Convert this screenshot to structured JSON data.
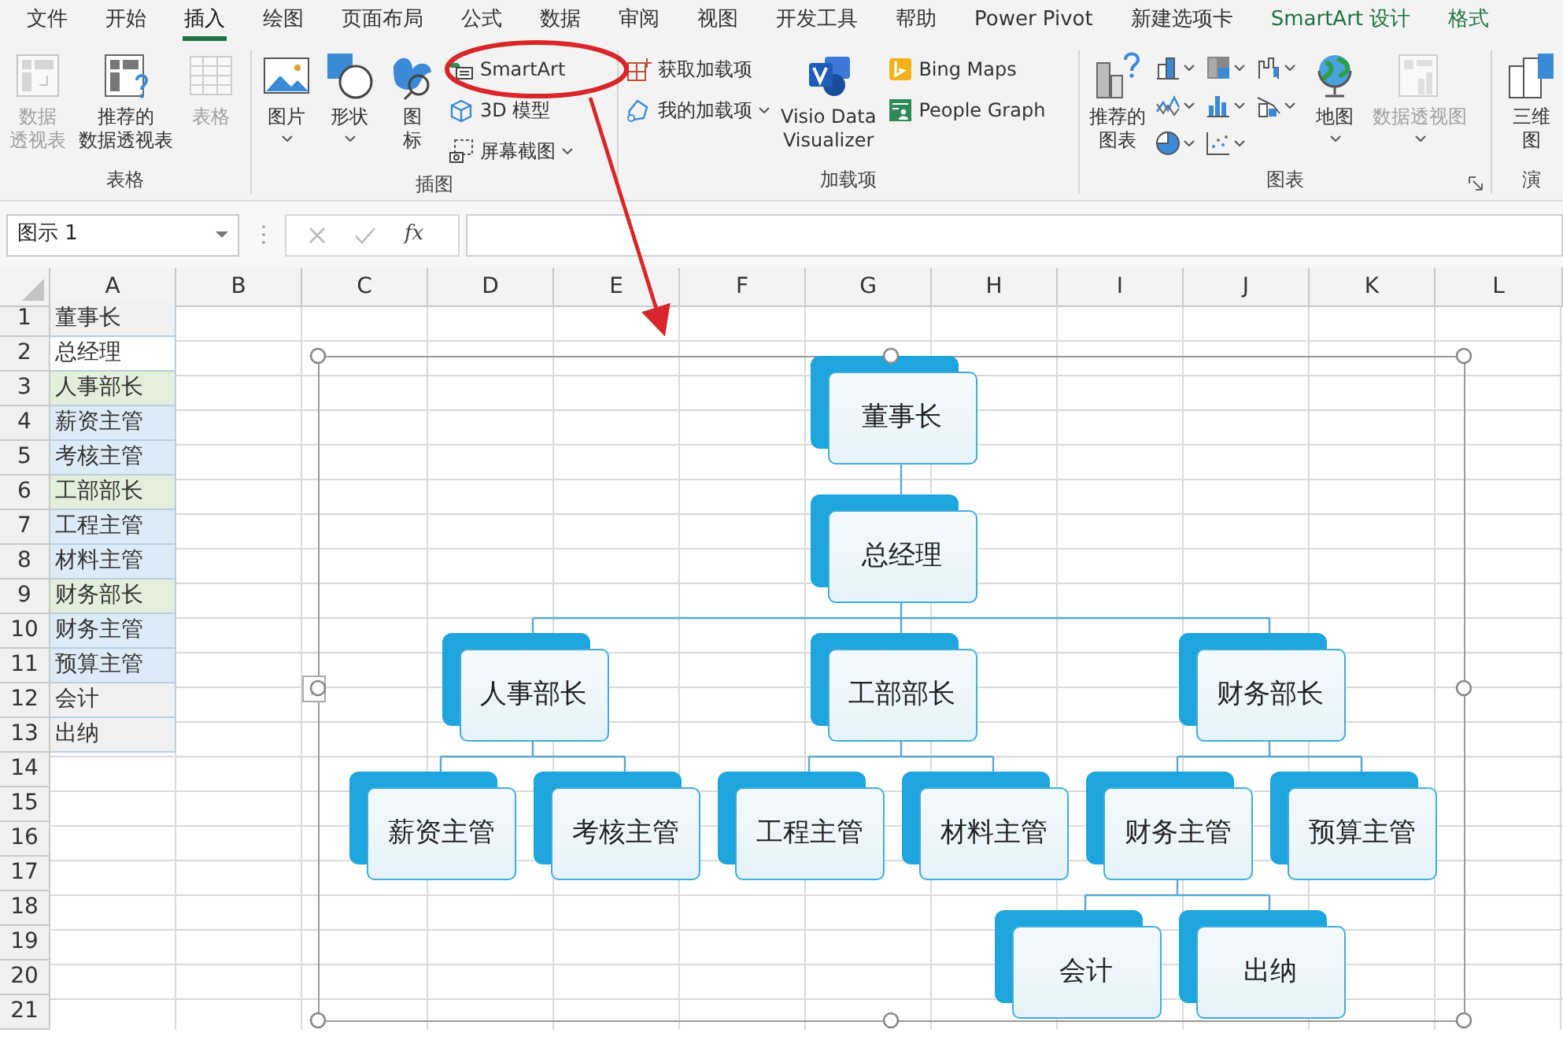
{
  "tabs": [
    {
      "label": "文件",
      "selected": false,
      "kind": "normal"
    },
    {
      "label": "开始",
      "selected": false,
      "kind": "normal"
    },
    {
      "label": "插入",
      "selected": true,
      "kind": "normal"
    },
    {
      "label": "绘图",
      "selected": false,
      "kind": "normal"
    },
    {
      "label": "页面布局",
      "selected": false,
      "kind": "normal"
    },
    {
      "label": "公式",
      "selected": false,
      "kind": "normal"
    },
    {
      "label": "数据",
      "selected": false,
      "kind": "normal"
    },
    {
      "label": "审阅",
      "selected": false,
      "kind": "normal"
    },
    {
      "label": "视图",
      "selected": false,
      "kind": "normal"
    },
    {
      "label": "开发工具",
      "selected": false,
      "kind": "normal"
    },
    {
      "label": "帮助",
      "selected": false,
      "kind": "normal"
    },
    {
      "label": "Power Pivot",
      "selected": false,
      "kind": "normal"
    },
    {
      "label": "新建选项卡",
      "selected": false,
      "kind": "normal"
    },
    {
      "label": "SmartArt 设计",
      "selected": false,
      "kind": "contextual"
    },
    {
      "label": "格式",
      "selected": false,
      "kind": "contextual"
    }
  ],
  "ribbon": {
    "groups": [
      {
        "label": "表格",
        "launcher": false,
        "columns": [
          {
            "kind": "single",
            "buttons": [
              {
                "kind": "pivot",
                "lines": [
                  "数据",
                  "透视表"
                ],
                "disabled": true,
                "dropdown": false
              }
            ]
          },
          {
            "kind": "single",
            "buttons": [
              {
                "kind": "recpivot",
                "lines": [
                  "推荐的",
                  "数据透视表"
                ],
                "disabled": false,
                "dropdown": false
              }
            ]
          },
          {
            "kind": "single",
            "buttons": [
              {
                "kind": "table",
                "lines": [
                  "表格"
                ],
                "disabled": true,
                "dropdown": false
              }
            ]
          }
        ]
      },
      {
        "label": "插图",
        "launcher": false,
        "columns": [
          {
            "kind": "single",
            "buttons": [
              {
                "kind": "picture",
                "lines": [
                  "图片"
                ],
                "disabled": false,
                "dropdown": true
              }
            ]
          },
          {
            "kind": "single",
            "buttons": [
              {
                "kind": "shapes",
                "lines": [
                  "形状"
                ],
                "disabled": false,
                "dropdown": true
              }
            ]
          },
          {
            "kind": "single",
            "buttons": [
              {
                "kind": "icons",
                "lines": [
                  "图",
                  "标"
                ],
                "disabled": false,
                "dropdown": false
              }
            ]
          },
          {
            "kind": "stack",
            "buttons": [
              {
                "kind": "smartart",
                "label": "SmartArt",
                "disabled": false,
                "dropdown": false
              },
              {
                "kind": "model3d",
                "label": "3D 模型",
                "disabled": false,
                "dropdown": false
              },
              {
                "kind": "screenshot",
                "label": "屏幕截图",
                "disabled": false,
                "dropdown": true
              }
            ]
          }
        ]
      },
      {
        "label": "加载项",
        "launcher": false,
        "columns": [
          {
            "kind": "stack",
            "buttons": [
              {
                "kind": "getaddin",
                "label": "获取加载项",
                "disabled": false,
                "dropdown": false
              },
              {
                "kind": "myaddin",
                "label": "我的加载项",
                "disabled": false,
                "dropdown": true
              }
            ]
          },
          {
            "kind": "single",
            "buttons": [
              {
                "kind": "visio",
                "lines": [
                  "Visio Data",
                  "Visualizer"
                ],
                "disabled": false,
                "dropdown": false
              }
            ]
          },
          {
            "kind": "stack",
            "buttons": [
              {
                "kind": "bing",
                "label": "Bing Maps",
                "disabled": false,
                "dropdown": false
              },
              {
                "kind": "people",
                "label": "People Graph",
                "disabled": false,
                "dropdown": false
              }
            ]
          }
        ]
      },
      {
        "label": "图表",
        "launcher": true,
        "columns": [
          {
            "kind": "single",
            "buttons": [
              {
                "kind": "recchart",
                "lines": [
                  "推荐的",
                  "图表"
                ],
                "disabled": false,
                "dropdown": false
              }
            ]
          },
          {
            "kind": "grid",
            "buttons": [
              {
                "kind": "column",
                "disabled": false,
                "dropdown": true
              },
              {
                "kind": "treemap",
                "disabled": false,
                "dropdown": true
              },
              {
                "kind": "waterfall",
                "disabled": false,
                "dropdown": true
              },
              {
                "kind": "line",
                "disabled": false,
                "dropdown": true
              },
              {
                "kind": "histogram",
                "disabled": false,
                "dropdown": true
              },
              {
                "kind": "combo",
                "disabled": false,
                "dropdown": true
              },
              {
                "kind": "pie",
                "disabled": false,
                "dropdown": true
              },
              {
                "kind": "scatter",
                "disabled": false,
                "dropdown": true
              }
            ]
          },
          {
            "kind": "single",
            "buttons": [
              {
                "kind": "map",
                "lines": [
                  "地图"
                ],
                "disabled": false,
                "dropdown": true
              }
            ]
          },
          {
            "kind": "single",
            "buttons": [
              {
                "kind": "pivotchart",
                "lines": [
                  "数据透视图"
                ],
                "disabled": true,
                "dropdown": true
              }
            ]
          }
        ]
      },
      {
        "label": "演",
        "launcher": false,
        "columns": [
          {
            "kind": "single",
            "buttons": [
              {
                "kind": "map3d",
                "lines": [
                  "三维",
                  "图"
                ],
                "disabled": false,
                "dropdown": false
              }
            ]
          }
        ]
      }
    ]
  },
  "formula_bar": {
    "name_box": "图示 1",
    "function_label": "fx"
  },
  "sheet": {
    "columns": [
      "A",
      "B",
      "C",
      "D",
      "E",
      "F",
      "G",
      "H",
      "I",
      "J",
      "K",
      "L"
    ],
    "rows": [
      {
        "number": "1",
        "a": "董事长",
        "color": "#f0f0f0"
      },
      {
        "number": "2",
        "a": "总经理",
        "color": "#ffffff"
      },
      {
        "number": "3",
        "a": "人事部长",
        "color": "#e2efda"
      },
      {
        "number": "4",
        "a": "薪资主管",
        "color": "#ddebf7"
      },
      {
        "number": "5",
        "a": "考核主管",
        "color": "#ddebf7"
      },
      {
        "number": "6",
        "a": "工部部长",
        "color": "#e2efda"
      },
      {
        "number": "7",
        "a": "工程主管",
        "color": "#ddebf7"
      },
      {
        "number": "8",
        "a": "材料主管",
        "color": "#ddebf7"
      },
      {
        "number": "9",
        "a": "财务部长",
        "color": "#e2efda"
      },
      {
        "number": "10",
        "a": "财务主管",
        "color": "#ddebf7"
      },
      {
        "number": "11",
        "a": "预算主管",
        "color": "#ddebf7"
      },
      {
        "number": "12",
        "a": "会计",
        "color": "#f0f0f0"
      },
      {
        "number": "13",
        "a": "出纳",
        "color": "#f0f0f0"
      },
      {
        "number": "14"
      },
      {
        "number": "15"
      },
      {
        "number": "16"
      },
      {
        "number": "17"
      },
      {
        "number": "18"
      },
      {
        "number": "19"
      },
      {
        "number": "20"
      },
      {
        "number": "21"
      }
    ]
  },
  "smartart": {
    "root": {
      "label": "董事长",
      "children": [
        {
          "label": "总经理",
          "children": [
            {
              "label": "人事部长",
              "children": [
                {
                  "label": "薪资主管"
                },
                {
                  "label": "考核主管"
                }
              ]
            },
            {
              "label": "工部部长",
              "children": [
                {
                  "label": "工程主管"
                },
                {
                  "label": "材料主管"
                }
              ]
            },
            {
              "label": "财务部长",
              "children": [
                {
                  "label": "财务主管",
                  "children": [
                    {
                      "label": "会计"
                    },
                    {
                      "label": "出纳"
                    }
                  ]
                },
                {
                  "label": "预算主管"
                }
              ]
            }
          ]
        }
      ]
    }
  }
}
